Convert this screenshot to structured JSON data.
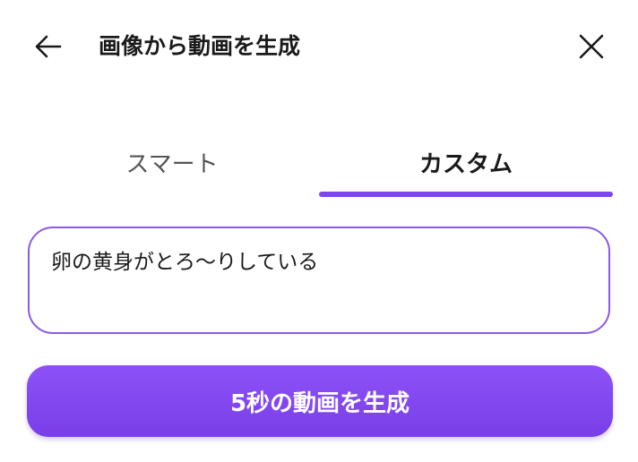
{
  "header": {
    "title": "画像から動画を生成",
    "back_icon": "arrow-left-icon",
    "close_icon": "close-icon"
  },
  "tabs": [
    {
      "label": "スマート",
      "selected": false
    },
    {
      "label": "カスタム",
      "selected": true
    }
  ],
  "prompt": {
    "value": "卵の黄身がとろ〜りしている"
  },
  "generate_button": {
    "label": "5秒の動画を生成"
  },
  "colors": {
    "accent": "#7c45ef",
    "button_gradient_top": "#8c52f7",
    "button_gradient_bottom": "#7a3ee8",
    "input_border": "#8a5ae6",
    "text_primary": "#1a1a1a",
    "text_secondary": "#555555"
  }
}
